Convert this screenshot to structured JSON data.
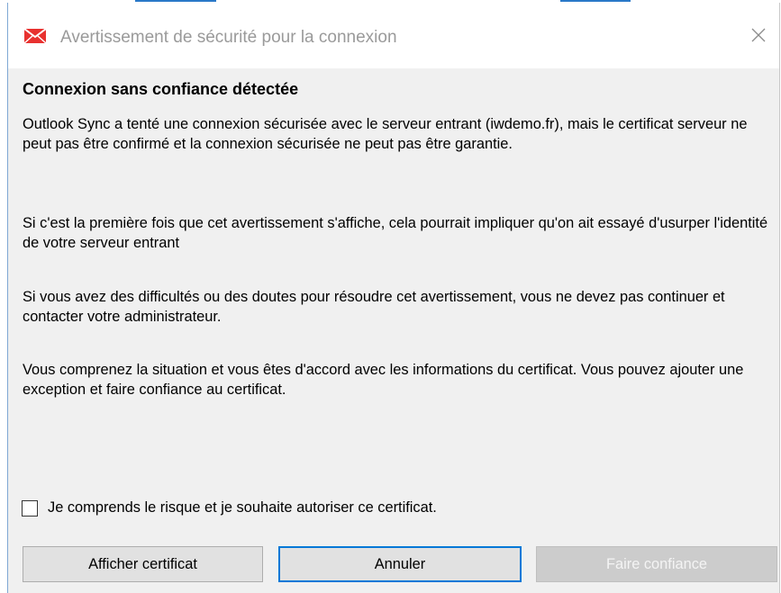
{
  "window": {
    "title": "Avertissement de sécurité pour la connexion",
    "icon": "envelope-app-icon",
    "close_icon": "close-icon"
  },
  "main": {
    "heading": "Connexion sans confiance détectée",
    "paragraphs": [
      "Outlook Sync a tenté une connexion sécurisée avec le serveur entrant (iwdemo.fr), mais le certificat serveur ne peut pas être confirmé et la connexion sécurisée ne peut pas être garantie.",
      "Si c'est la première fois que cet avertissement s'affiche, cela pourrait impliquer qu'on ait essayé d'usurper l'identité de votre serveur entrant",
      "Si vous avez des difficultés ou des doutes pour résoudre cet avertissement, vous ne devez pas continuer et contacter votre administrateur.",
      "Vous comprenez la situation et vous êtes d'accord avec les informations du certificat. Vous pouvez ajouter une exception et faire confiance au certificat."
    ],
    "consent": {
      "label": "Je comprends le risque et je souhaite autoriser ce certificat.",
      "checked": false
    }
  },
  "buttons": {
    "show_certificate": "Afficher certificat",
    "cancel": "Annuler",
    "trust": "Faire confiance"
  },
  "colors": {
    "accent": "#0078d7",
    "dialog_bg": "#f0f0f0",
    "disabled_text": "#f4f4f4",
    "icon_red": "#e8312f"
  }
}
